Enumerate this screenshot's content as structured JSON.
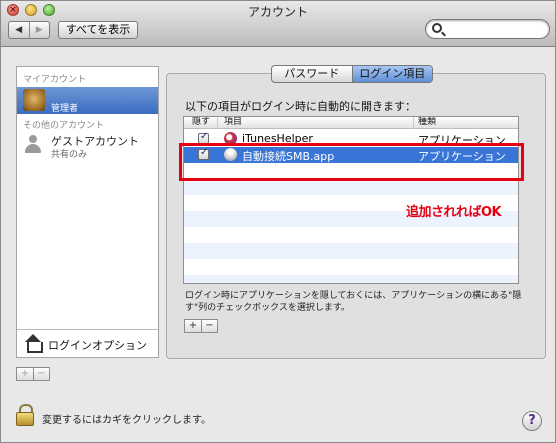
{
  "window": {
    "title": "アカウント"
  },
  "toolbar": {
    "back_glyph": "◀",
    "forward_glyph": "▶",
    "show_all_label": "すべてを表示",
    "search_placeholder": ""
  },
  "sidebar": {
    "my_account_header": "マイアカウント",
    "current_user": {
      "name": "管理者"
    },
    "other_accounts_header": "その他のアカウント",
    "guest": {
      "name": "ゲストアカウント",
      "subtitle": "共有のみ"
    },
    "login_options_label": "ログインオプション",
    "add_label": "+",
    "remove_label": "−"
  },
  "tabs": [
    {
      "label": "パスワード",
      "active": false
    },
    {
      "label": "ログイン項目",
      "active": true
    }
  ],
  "login_items": {
    "instruction": "以下の項目がログイン時に自動的に開きます：",
    "columns": {
      "hide": "隠す",
      "item": "項目",
      "kind": "種類"
    },
    "rows": [
      {
        "checked": true,
        "icon": "itunes-icon",
        "name": "iTunesHelper",
        "kind": "アプリケーション"
      },
      {
        "checked": true,
        "icon": "smb-app-icon",
        "name": "自動接続SMB.app",
        "kind": "アプリケーション"
      }
    ],
    "footnote": "ログイン時にアプリケーションを隠しておくには、アプリケーションの横にある\"隠す\"列のチェックボックスを選択します。",
    "add_label": "+",
    "remove_label": "−"
  },
  "annotation": {
    "text": "追加されればOK",
    "color": "#e60012"
  },
  "footer": {
    "lock_text": "変更するにはカギをクリックします。",
    "help_label": "?"
  },
  "colors": {
    "selection": "#3875d7",
    "active_tab": "#5f8fd5"
  }
}
